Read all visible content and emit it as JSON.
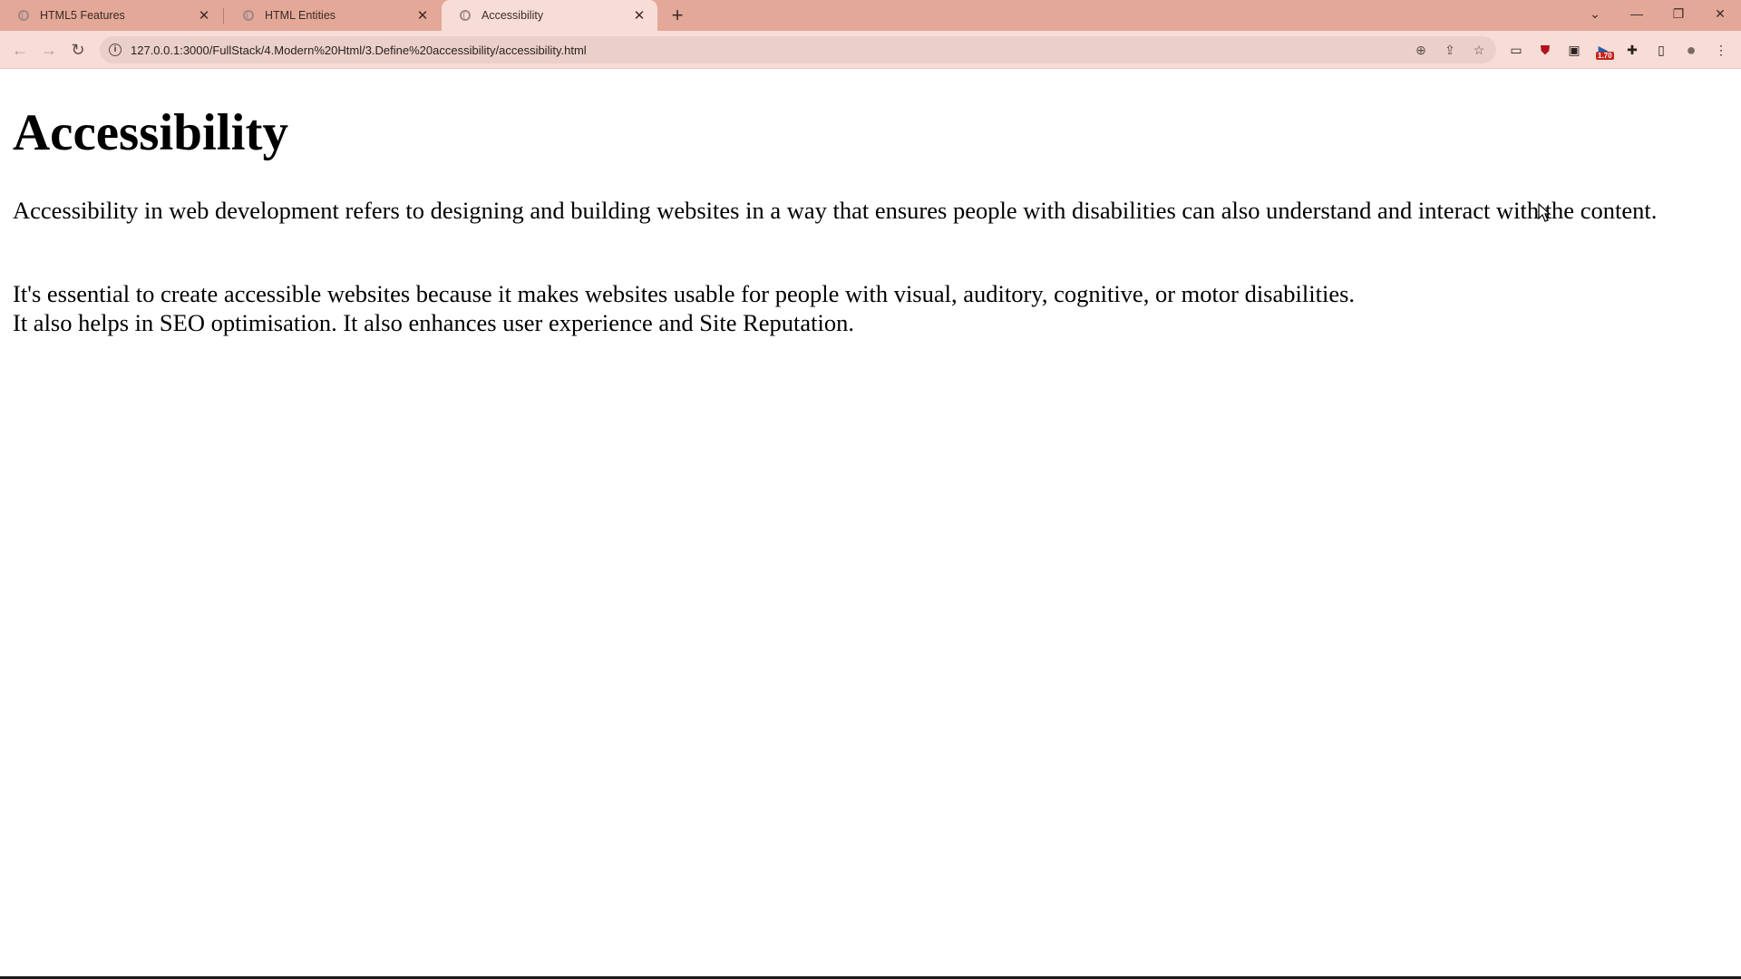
{
  "colors": {
    "tabstrip_bg": "#e3a898",
    "active_tab_bg": "#f7ddd6",
    "omnibox_bg": "#ead0c9",
    "page_bg": "#ffffff",
    "text": "#000000"
  },
  "tabs": [
    {
      "title": "HTML5 Features",
      "icon": "globe-icon",
      "active": false
    },
    {
      "title": "HTML Entities",
      "icon": "globe-icon",
      "active": false
    },
    {
      "title": "Accessibility",
      "icon": "globe-icon",
      "active": true
    }
  ],
  "tab_close_glyph": "✕",
  "new_tab_glyph": "+",
  "window_controls": {
    "tab_search": "⌄",
    "minimize": "—",
    "restore": "❐",
    "close": "✕"
  },
  "toolbar": {
    "back_glyph": "←",
    "forward_glyph": "→",
    "reload_glyph": "↻",
    "info_glyph": "i",
    "url": "127.0.0.1:3000/FullStack/4.Modern%20Html/3.Define%20accessibility/accessibility.html",
    "zoom_glyph": "⊕",
    "share_glyph": "⇪",
    "bookmark_glyph": "☆",
    "extensions": [
      {
        "name": "extension-cc-icon",
        "glyph": "▭"
      },
      {
        "name": "ublock-shield-icon",
        "glyph": "⛊"
      },
      {
        "name": "extension-pip-icon",
        "glyph": "▣"
      },
      {
        "name": "extension-speed-icon",
        "glyph": "▶",
        "badge": "1.70"
      },
      {
        "name": "puzzle-icon",
        "glyph": "✚"
      },
      {
        "name": "side-panel-icon",
        "glyph": "▯"
      },
      {
        "name": "profile-avatar-icon",
        "glyph": "●"
      },
      {
        "name": "kebab-menu-icon",
        "glyph": "⋮"
      }
    ]
  },
  "page": {
    "heading": "Accessibility",
    "paragraph1": "Accessibility in web development refers to designing and building websites in a way that ensures people with disabilities can also understand and interact with the content.",
    "paragraph2_line1": "It's essential to create accessible websites because it makes websites usable for people with visual, auditory, cognitive, or motor disabilities.",
    "paragraph2_line2": "It also helps in SEO optimisation. It also enhances user experience and Site Reputation."
  }
}
